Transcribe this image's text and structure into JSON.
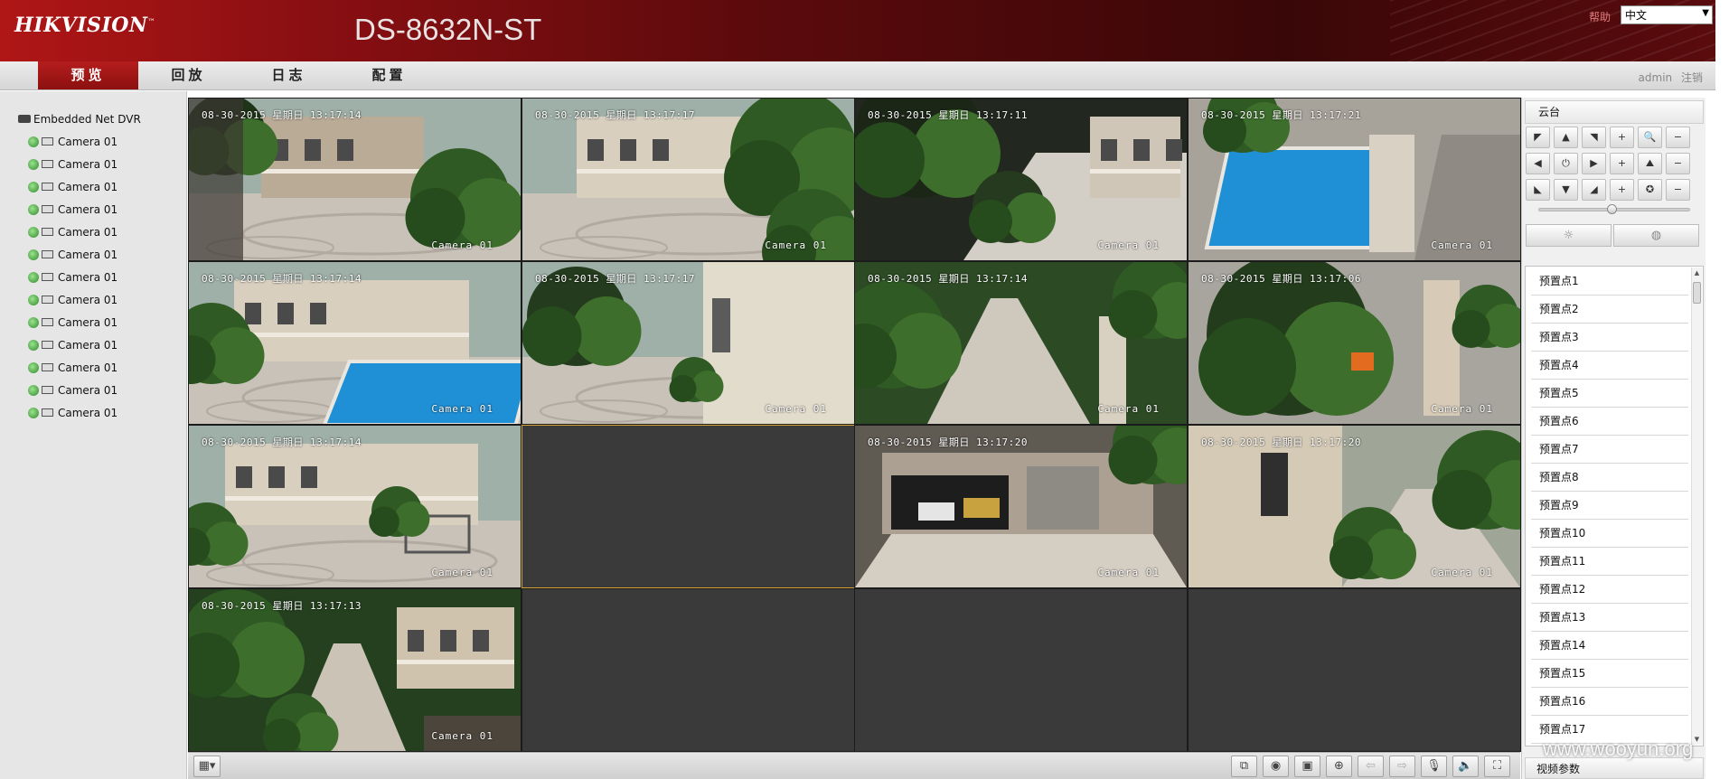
{
  "header": {
    "brand_logo": "HIKVISION",
    "brand_logo_tm": "™",
    "model_title": "DS-8632N-ST",
    "help_label": "帮助",
    "language_selected": "中文"
  },
  "nav": {
    "tabs": [
      {
        "label": "预览",
        "active": true
      },
      {
        "label": "回放",
        "active": false
      },
      {
        "label": "日志",
        "active": false
      },
      {
        "label": "配置",
        "active": false
      }
    ],
    "user": "admin",
    "logout_label": "注销"
  },
  "tree": {
    "root_label": "Embedded Net DVR",
    "cameras": [
      {
        "label": "Camera 01"
      },
      {
        "label": "Camera 01"
      },
      {
        "label": "Camera 01"
      },
      {
        "label": "Camera 01"
      },
      {
        "label": "Camera 01"
      },
      {
        "label": "Camera 01"
      },
      {
        "label": "Camera 01"
      },
      {
        "label": "Camera 01"
      },
      {
        "label": "Camera 01"
      },
      {
        "label": "Camera 01"
      },
      {
        "label": "Camera 01"
      },
      {
        "label": "Camera 01"
      },
      {
        "label": "Camera 01"
      }
    ]
  },
  "video": {
    "channels": [
      {
        "timestamp": "08-30-2015 星期日 13:17:14",
        "label": "Camera 01",
        "scene": "courtyard"
      },
      {
        "timestamp": "08-30-2015 星期日 13:17:17",
        "label": "Camera 01",
        "scene": "garden"
      },
      {
        "timestamp": "08-30-2015 星期日 13:17:11",
        "label": "Camera 01",
        "scene": "tree"
      },
      {
        "timestamp": "08-30-2015 星期日 13:17:21",
        "label": "Camera 01",
        "scene": "pool"
      },
      {
        "timestamp": "08-30-2015 星期日 13:17:14",
        "label": "Camera 01",
        "scene": "house-pool"
      },
      {
        "timestamp": "08-30-2015 星期日 13:17:17",
        "label": "Camera 01",
        "scene": "wall"
      },
      {
        "timestamp": "08-30-2015 星期日 13:17:14",
        "label": "Camera 01",
        "scene": "path"
      },
      {
        "timestamp": "08-30-2015 星期日 13:17:06",
        "label": "Camera 01",
        "scene": "foliage"
      },
      {
        "timestamp": "08-30-2015 星期日 13:17:14",
        "label": "Camera 01",
        "scene": "terrace"
      },
      {
        "timestamp": "",
        "label": "",
        "scene": "empty",
        "selected": true
      },
      {
        "timestamp": "08-30-2015 星期日 13:17:20",
        "label": "Camera 01",
        "scene": "garage"
      },
      {
        "timestamp": "08-30-2015 星期日 13:17:20",
        "label": "Camera 01",
        "scene": "side"
      },
      {
        "timestamp": "08-30-2015 星期日 13:17:13",
        "label": "Camera 01",
        "scene": "greenpath"
      },
      {
        "timestamp": "",
        "label": "",
        "scene": "empty"
      },
      {
        "timestamp": "",
        "label": "",
        "scene": "empty"
      },
      {
        "timestamp": "",
        "label": "",
        "scene": "empty"
      }
    ]
  },
  "ptz": {
    "header": "云台",
    "speed_level": 0.48,
    "presets": [
      "预置点1",
      "预置点2",
      "预置点3",
      "预置点4",
      "预置点5",
      "预置点6",
      "预置点7",
      "预置点8",
      "预置点9",
      "预置点10",
      "预置点11",
      "预置点12",
      "预置点13",
      "预置点14",
      "预置点15",
      "预置点16",
      "预置点17"
    ],
    "video_params_label": "视频参数"
  },
  "toolbar": {
    "icons": [
      "layout-grid-icon",
      "stop-all-icon",
      "snapshot-icon",
      "record-icon",
      "zoom-icon",
      "prev-page-icon",
      "next-page-icon",
      "microphone-icon",
      "volume-icon",
      "fullscreen-icon"
    ]
  },
  "watermark": "www.wooyun.org",
  "colors": {
    "brand_red": "#b01616",
    "active_tab": "#a31515",
    "selected_tile_border": "#d6a234",
    "online_status": "#2f8a2a"
  }
}
